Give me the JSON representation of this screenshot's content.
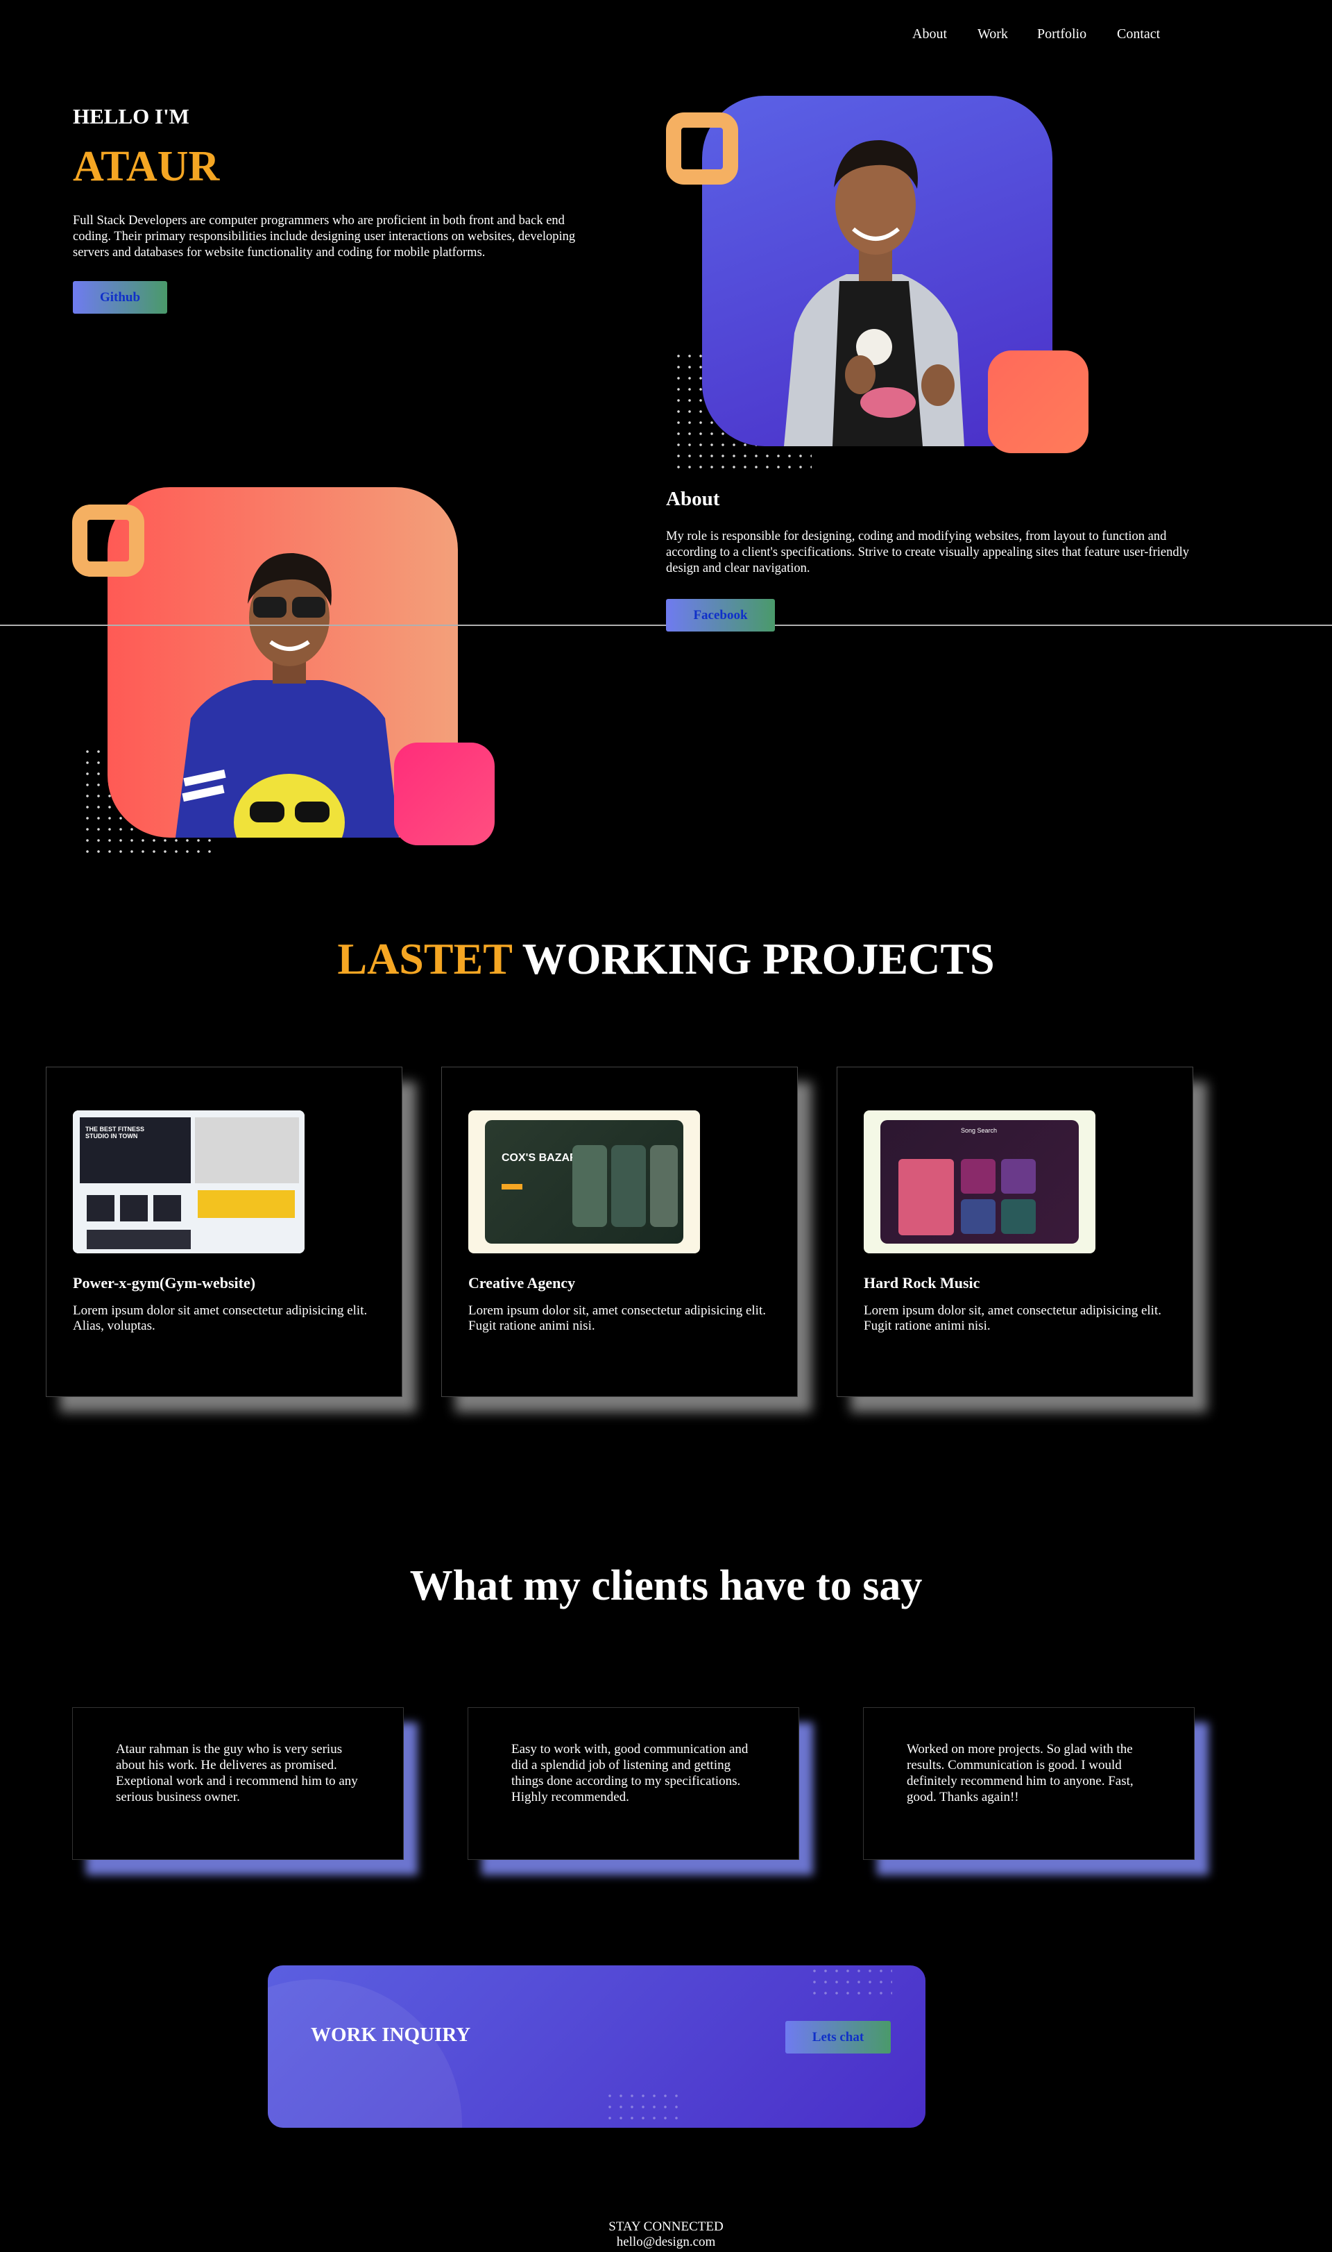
{
  "nav": {
    "items": [
      "About",
      "Work",
      "Portfolio",
      "Contact"
    ]
  },
  "hero": {
    "greeting": "HELLO I'M",
    "name": "ATAUR",
    "description": "Full Stack Developers are computer programmers who are proficient in both front and back end coding. Their primary responsibilities include designing user interactions on websites, developing servers and databases for website functionality and coding for mobile platforms.",
    "github_button": "Github"
  },
  "about": {
    "title": "About",
    "description": "My role is responsible for designing, coding and modifying websites, from layout to function and according to a client's specifications. Strive to create visually appealing sites that feature user-friendly design and clear navigation.",
    "facebook_button": "Facebook"
  },
  "projects": {
    "title_highlight": "LASTET",
    "title_rest": "WORKING PROJECTS",
    "items": [
      {
        "title": "Power-x-gym(Gym-website)",
        "description": "Lorem ipsum dolor sit amet consectetur adipisicing elit. Alias, voluptas."
      },
      {
        "title": "Creative Agency",
        "description": "Lorem ipsum dolor sit, amet consectetur adipisicing elit. Fugit ratione animi nisi."
      },
      {
        "title": "Hard Rock Music",
        "description": "Lorem ipsum dolor sit, amet consectetur adipisicing elit. Fugit ratione animi nisi."
      }
    ],
    "thumb_texts": {
      "gym_headline": "THE BEST FITNESS STUDIO IN TOWN",
      "agency_headline": "COX'S BAZAR",
      "music_headline": "Song Search"
    }
  },
  "testimonials": {
    "title": "What my clients have to say",
    "items": [
      "Ataur rahman is the guy who is very serius about his work. He deliveres as promised. Exeptional work and i recommend him to any serious business owner.",
      "Easy to work with, good communication and did a splendid job of listening and getting things done according to my specifications. Highly recommended.",
      "Worked on more projects. So glad with the results. Communication is good. I would definitely recommend him to anyone. Fast, good. Thanks again!!"
    ]
  },
  "inquiry": {
    "title": "WORK INQUIRY",
    "button": "Lets chat"
  },
  "footer": {
    "title": "STAY CONNECTED",
    "email": "hello@design.com"
  },
  "colors": {
    "accent_orange": "#f5a623",
    "purple": "#5b55e0",
    "coral": "#ff6a5a",
    "pink": "#ff2d7a",
    "ring": "#f5b062"
  }
}
